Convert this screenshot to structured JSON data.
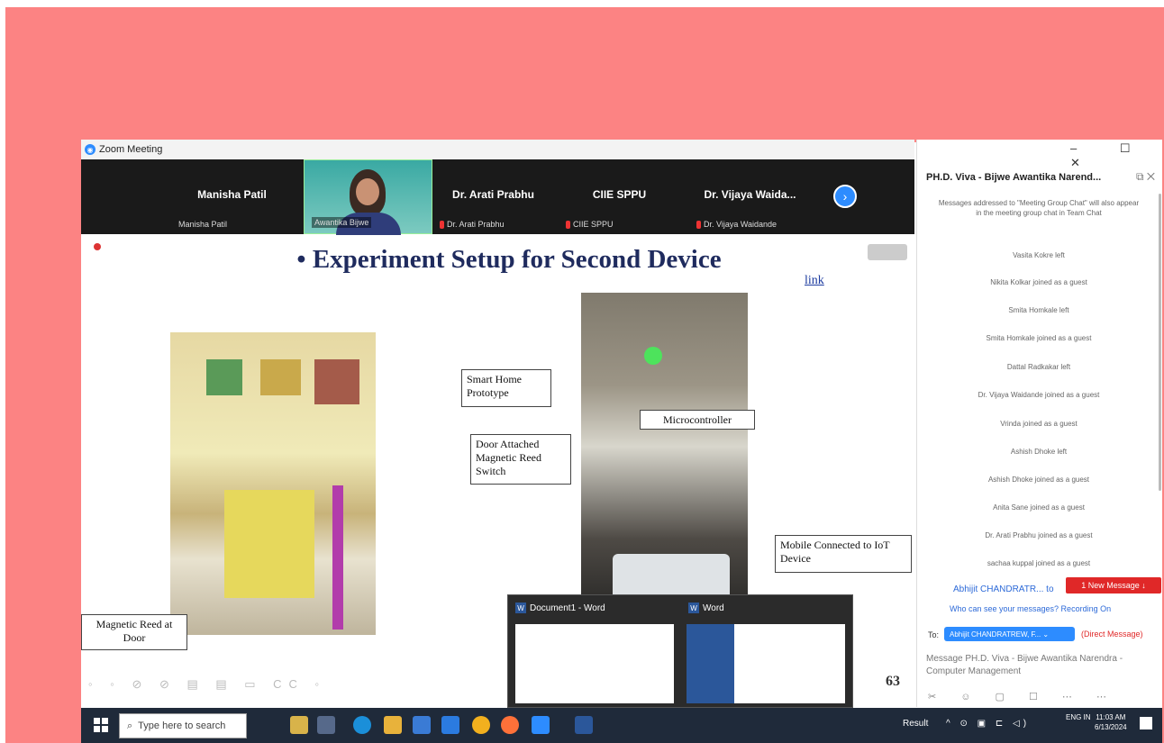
{
  "window": {
    "title": "Zoom Meeting",
    "controls": "–  ☐  ✕"
  },
  "gallery": {
    "tiles": [
      {
        "name": "Manisha Patil",
        "label": "Manisha Patil"
      },
      {
        "name": "",
        "label": "Awantika Bijwe"
      },
      {
        "name": "Dr. Arati Prabhu",
        "label": "Dr. Arati Prabhu"
      },
      {
        "name": "CIIE SPPU",
        "label": "CIIE SPPU"
      },
      {
        "name": "Dr. Vijaya Waida...",
        "label": "Dr. Vijaya Waidande"
      }
    ]
  },
  "slide": {
    "title": "• Experiment Setup for Second Device",
    "link": "link",
    "number": "63",
    "callouts": {
      "smart_home": "Smart Home Prototype",
      "door_reed": "Door Attached Magnetic Reed Switch",
      "microcontroller": "Microcontroller",
      "mobile": "Mobile Connected to IoT Device",
      "magnetic_door": "Magnetic Reed at Door"
    },
    "toolbar": "◦ ◦ ⊘ ⊘ ▤ ▤ ▭ CC ◦"
  },
  "previews": {
    "doc1": "Document1 - Word",
    "word": "Word"
  },
  "chat": {
    "title": "PH.D. Viva - Bijwe Awantika Narend...",
    "info": "Messages addressed to \"Meeting Group Chat\" will also appear in the meeting group chat in Team Chat",
    "events": [
      "Vasita Kokre left",
      "Nikita Kolkar joined as a guest",
      "Smita Homkale left",
      "Smita Homkale joined as a guest",
      "Dattal Radkakar left",
      "Dr. Vijaya Waidande joined as a guest",
      "Vrinda joined as a guest",
      "Ashish Dhoke left",
      "Ashish Dhoke joined as a guest",
      "Anita Sane joined as a guest",
      "Dr. Arati Prabhu joined as a guest",
      "sachaa kuppal joined as a guest"
    ],
    "last_sender": "Abhijit CHANDRATR... to",
    "new_message": "1 New Message ↓",
    "warning": "Who can see your messages? Recording On",
    "to_label": "To:",
    "recipient": "Abhijit CHANDRATREW, F... ⌄",
    "direct": "(Direct Message)",
    "input_placeholder": "Message PH.D. Viva - Bijwe Awantika Narendra - Computer Management",
    "tools": "✂ ☺ ▢ ☐ ⋯ ⋯"
  },
  "taskbar": {
    "search_placeholder": "Type here to search",
    "result": "Result",
    "tray": "^ ⊙ ▣ ⊏ ◁)",
    "lang": "ENG\nIN",
    "time": "11:03 AM",
    "date": "6/13/2024"
  },
  "colors": {
    "frame": "#fc8383",
    "zoom_blue": "#2d8cff",
    "title_navy": "#1f2b5e"
  }
}
